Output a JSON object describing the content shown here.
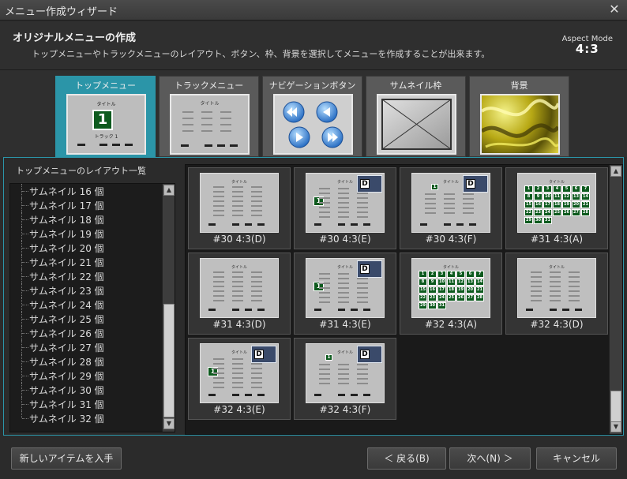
{
  "window": {
    "title": "メニュー作成ウィザード",
    "close_glyph": "✕"
  },
  "header": {
    "title": "オリジナルメニューの作成",
    "description": "トップメニューやトラックメニューのレイアウト、ボタン、枠、背景を選択してメニューを作成することが出来ます。",
    "aspect_label": "Aspect Mode",
    "aspect_value": "4:3"
  },
  "tabs": [
    {
      "label": "トップメニュー",
      "active": true
    },
    {
      "label": "トラックメニュー",
      "active": false
    },
    {
      "label": "ナビゲーションボタン",
      "active": false
    },
    {
      "label": "サムネイル枠",
      "active": false
    },
    {
      "label": "背景",
      "active": false
    }
  ],
  "tab_previews": {
    "top_menu_title": "タイトル",
    "top_menu_number": "1",
    "top_menu_track": "トラック 1",
    "track_menu_title": "タイトル"
  },
  "layout_list": {
    "label": "トップメニューのレイアウト一覧",
    "items": [
      "サムネイル 16 個",
      "サムネイル 17 個",
      "サムネイル 18 個",
      "サムネイル 19 個",
      "サムネイル 20 個",
      "サムネイル 21 個",
      "サムネイル 22 個",
      "サムネイル 23 個",
      "サムネイル 24 個",
      "サムネイル 25 個",
      "サムネイル 26 個",
      "サムネイル 27 個",
      "サムネイル 28 個",
      "サムネイル 29 個",
      "サムネイル 30 個",
      "サムネイル 31 個",
      "サムネイル 32 個"
    ]
  },
  "layouts": [
    {
      "label": "#30 4:3(D)",
      "style": "list",
      "badge": false
    },
    {
      "label": "#30 4:3(E)",
      "style": "list-green",
      "badge": true
    },
    {
      "label": "#30 4:3(F)",
      "style": "list-green-top",
      "badge": true
    },
    {
      "label": "#31 4:3(A)",
      "style": "grid",
      "badge": false
    },
    {
      "label": "#31 4:3(D)",
      "style": "list",
      "badge": false
    },
    {
      "label": "#31 4:3(E)",
      "style": "list-green",
      "badge": true
    },
    {
      "label": "#32 4:3(A)",
      "style": "grid",
      "badge": false
    },
    {
      "label": "#32 4:3(D)",
      "style": "list",
      "badge": false
    },
    {
      "label": "#32 4:3(E)",
      "style": "list-green",
      "badge": true
    },
    {
      "label": "#32 4:3(F)",
      "style": "list-green-top",
      "badge": true
    }
  ],
  "preview_text": {
    "title": "タイトル",
    "badge_letter": "D",
    "green_number": "1"
  },
  "buttons": {
    "get_items": "新しいアイテムを入手",
    "back": "＜ 戻る(B)",
    "next": "次へ(N) ＞",
    "cancel": "キャンセル"
  },
  "colors": {
    "accent": "#2b95a8",
    "green": "#0d5a1e"
  }
}
